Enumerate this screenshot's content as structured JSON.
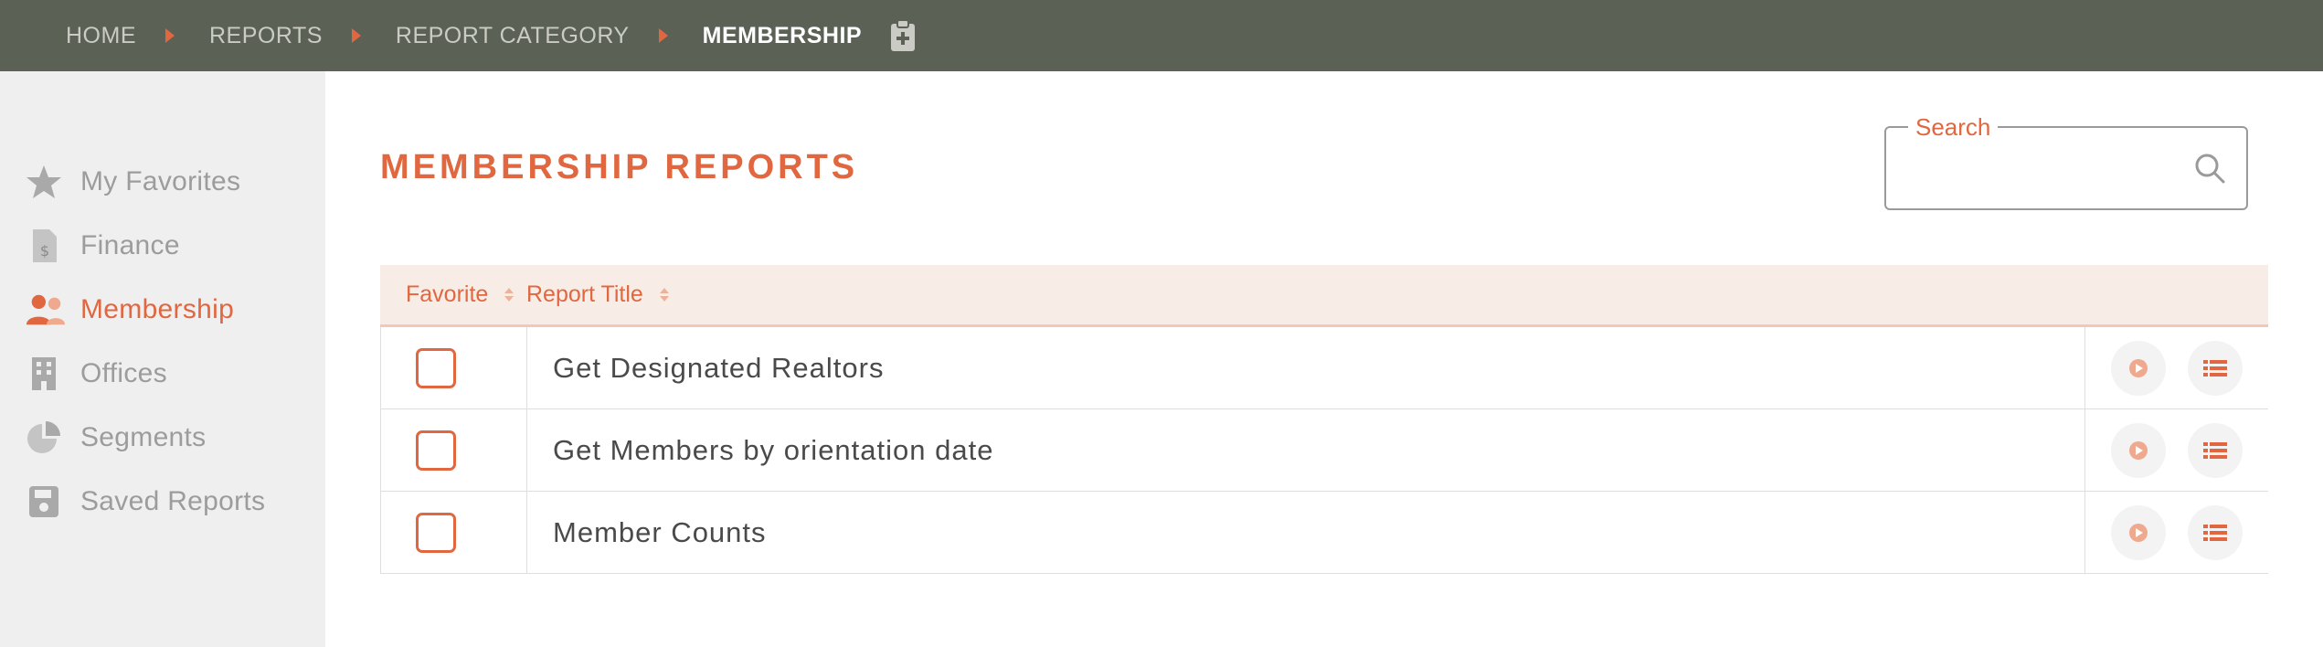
{
  "breadcrumb": {
    "items": [
      {
        "label": "HOME"
      },
      {
        "label": "REPORTS"
      },
      {
        "label": "REPORT CATEGORY"
      },
      {
        "label": "MEMBERSHIP"
      }
    ]
  },
  "sidebar": {
    "items": [
      {
        "label": "My Favorites",
        "icon": "star-icon"
      },
      {
        "label": "Finance",
        "icon": "finance-document-icon"
      },
      {
        "label": "Membership",
        "icon": "users-icon",
        "active": true
      },
      {
        "label": "Offices",
        "icon": "building-icon"
      },
      {
        "label": "Segments",
        "icon": "pie-chart-icon"
      },
      {
        "label": "Saved Reports",
        "icon": "save-icon"
      }
    ]
  },
  "main": {
    "title": "MEMBERSHIP REPORTS",
    "search": {
      "label": "Search",
      "placeholder": "",
      "value": ""
    }
  },
  "table": {
    "headers": {
      "favorite": "Favorite",
      "title": "Report Title"
    },
    "rows": [
      {
        "title": "Get Designated Realtors",
        "favorite": false
      },
      {
        "title": "Get Members by orientation date",
        "favorite": false
      },
      {
        "title": "Member Counts",
        "favorite": false
      }
    ]
  },
  "colors": {
    "accent": "#e0673f",
    "topbar": "#5c6155",
    "sidebar": "#efefef",
    "header_row": "#f8ede6"
  }
}
